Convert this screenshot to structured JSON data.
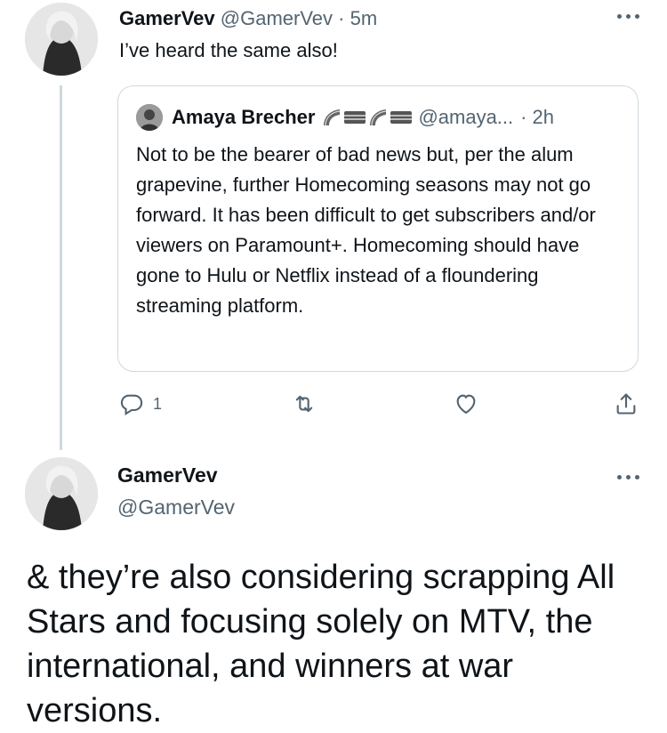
{
  "reply": {
    "author_name": "GamerVev",
    "author_handle": "@GamerVev",
    "separator": "·",
    "time": "5m",
    "text": "I’ve heard the same also!"
  },
  "quoted": {
    "author_name": "Amaya Brecher",
    "author_handle": "@amaya...",
    "separator": "·",
    "time": "2h",
    "text": "Not to be the bearer of bad news but, per the alum grapevine, further Homecoming seasons may not go forward. It has been difficult to get subscribers and/or viewers on Paramount+. Homecoming should have gone to Hulu or Netflix instead of a floundering streaming platform."
  },
  "actions": {
    "reply_count": "1",
    "icons": [
      "reply-icon",
      "retweet-icon",
      "like-icon",
      "share-icon"
    ]
  },
  "main_tweet": {
    "author_name": "GamerVev",
    "author_handle": "@GamerVev",
    "text": "& they’re also considering scrapping All Stars and focusing solely on MTV, the international, and winners at war versions."
  },
  "colors": {
    "text": "#0f1419",
    "secondary": "#536471",
    "border": "#cfd9de"
  }
}
